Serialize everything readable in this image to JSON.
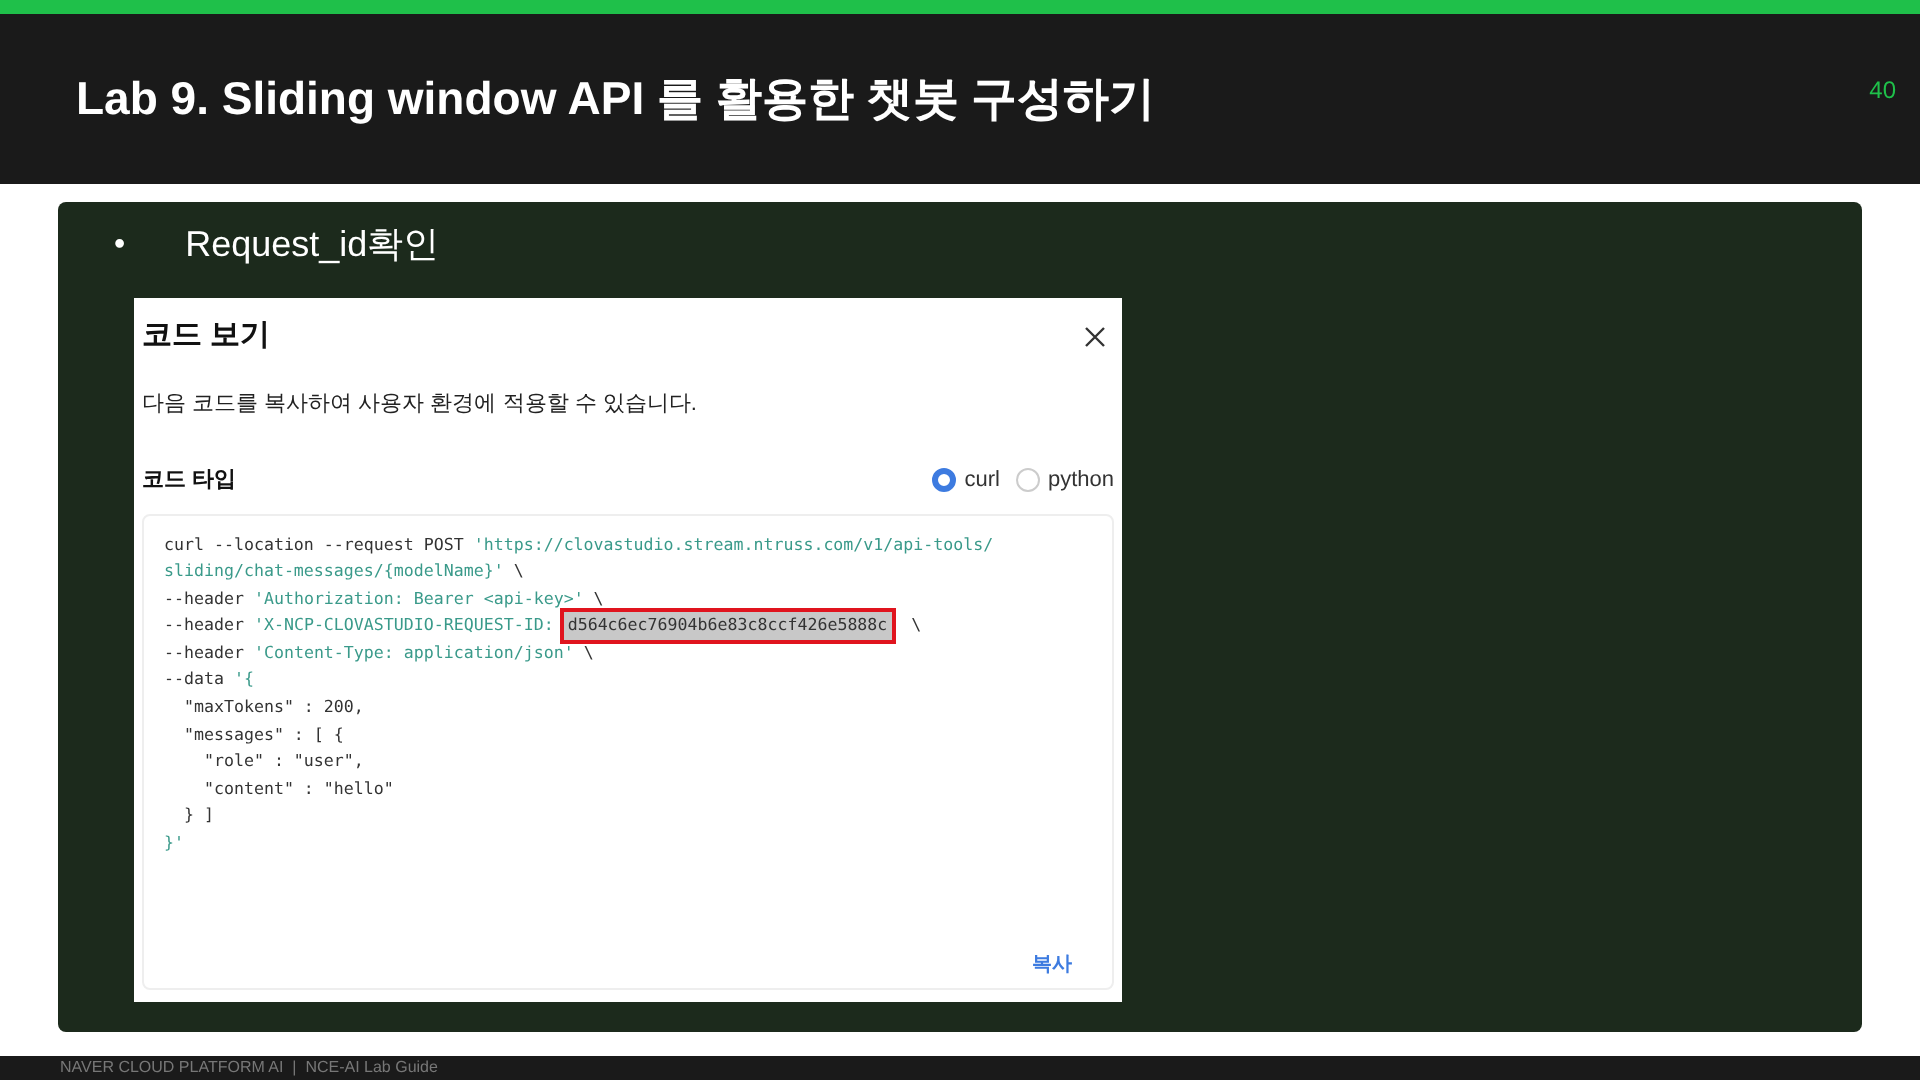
{
  "slide": {
    "title": "Lab 9. Sliding window API 를 활용한 챗봇 구성하기",
    "page_number": "40"
  },
  "bullet": {
    "marker": "•",
    "text": "Request_id확인"
  },
  "dialog": {
    "title": "코드 보기",
    "description": "다음 코드를 복사하여 사용자 환경에 적용할 수 있습니다.",
    "section_label": "코드 타입",
    "options": [
      {
        "label": "curl",
        "selected": true
      },
      {
        "label": "python",
        "selected": false
      }
    ],
    "code_lines": [
      [
        {
          "kind": "plain",
          "text": "curl --location --request POST "
        },
        {
          "kind": "string",
          "text": "'https://clovastudio.stream.ntruss.com/v1/api-tools/"
        }
      ],
      [
        {
          "kind": "string",
          "text": "sliding/chat-messages/{modelName}'"
        },
        {
          "kind": "plain",
          "text": " \\"
        }
      ],
      [
        {
          "kind": "plain",
          "text": "--header "
        },
        {
          "kind": "string",
          "text": "'Authorization: Bearer <api-key>'"
        },
        {
          "kind": "plain",
          "text": " \\"
        }
      ],
      [
        {
          "kind": "plain",
          "text": "--header "
        },
        {
          "kind": "string",
          "text": "'X-NCP-CLOVASTUDIO-REQUEST-ID: "
        },
        {
          "kind": "highlight",
          "text": "d564c6ec76904b6e83c8ccf426e5888c"
        },
        {
          "kind": "plain",
          "text": "  \\"
        }
      ],
      [
        {
          "kind": "plain",
          "text": "--header "
        },
        {
          "kind": "string",
          "text": "'Content-Type: application/json'"
        },
        {
          "kind": "plain",
          "text": " \\"
        }
      ],
      [
        {
          "kind": "plain",
          "text": "--data "
        },
        {
          "kind": "string",
          "text": "'{"
        }
      ],
      [
        {
          "kind": "plain",
          "text": "  \"maxTokens\" : 200,"
        }
      ],
      [
        {
          "kind": "plain",
          "text": "  \"messages\" : [ {"
        }
      ],
      [
        {
          "kind": "plain",
          "text": "    \"role\" : \"user\","
        }
      ],
      [
        {
          "kind": "plain",
          "text": "    \"content\" : \"hello\""
        }
      ],
      [
        {
          "kind": "plain",
          "text": "  } ]"
        }
      ],
      [
        {
          "kind": "string",
          "text": "}'"
        }
      ]
    ],
    "copy_button": "복사"
  },
  "footer": "NAVER CLOUD PLATFORM AI  |  NCE-AI Lab Guide"
}
